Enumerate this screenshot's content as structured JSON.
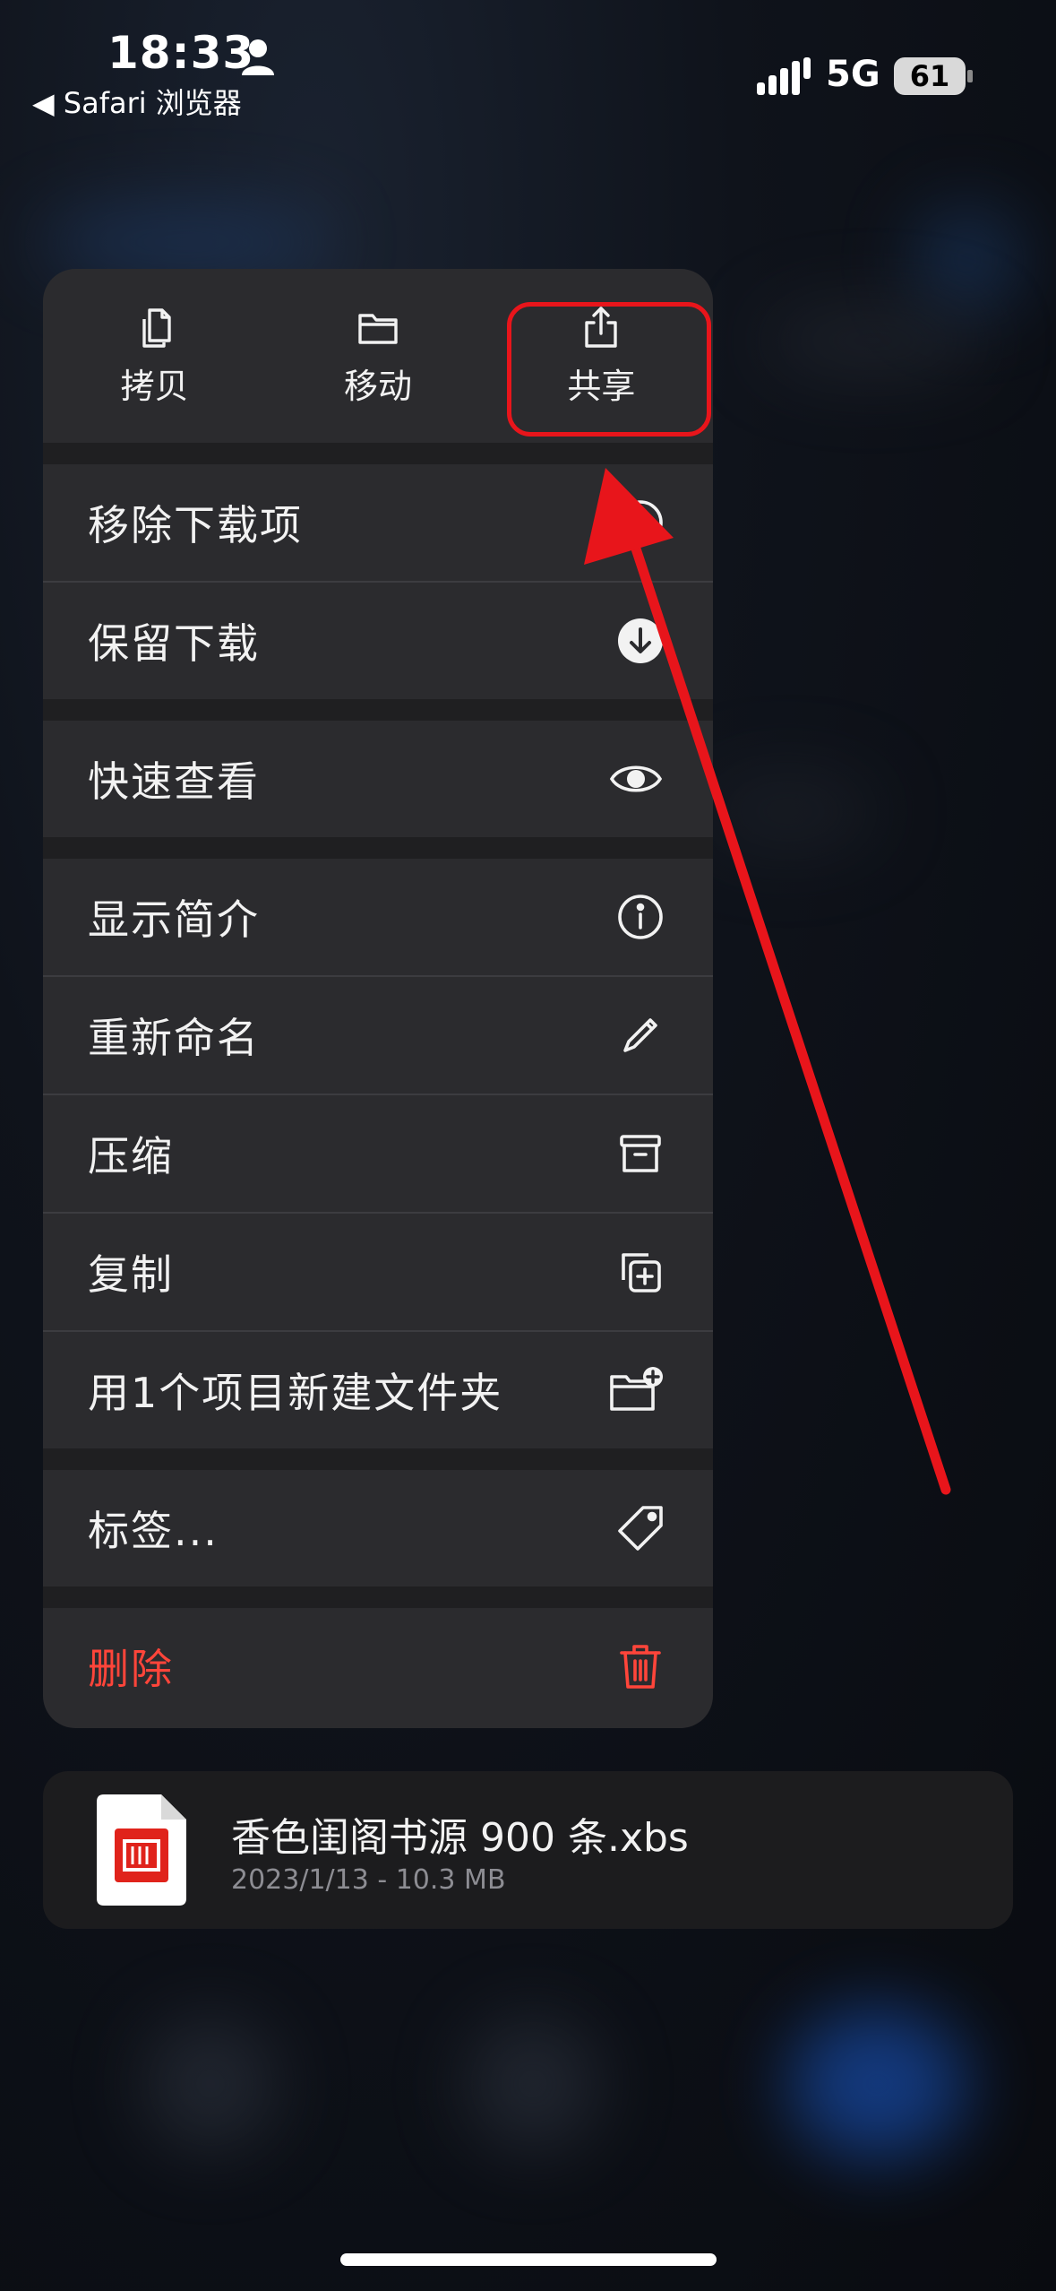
{
  "status_bar": {
    "time": "18:33",
    "back_app": "◀ Safari 浏览器",
    "network": "5G",
    "battery": "61"
  },
  "quick_actions": [
    {
      "label": "拷贝",
      "icon": "copy-icon"
    },
    {
      "label": "移动",
      "icon": "folder-icon"
    },
    {
      "label": "共享",
      "icon": "share-icon"
    }
  ],
  "menu": {
    "remove_download": "移除下载项",
    "keep_download": "保留下载",
    "quick_look": "快速查看",
    "get_info": "显示简介",
    "rename": "重新命名",
    "compress": "压缩",
    "duplicate": "复制",
    "new_folder": "用1个项目新建文件夹",
    "tags": "标签...",
    "delete": "删除"
  },
  "file": {
    "name": "香色闺阁书源 900 条.xbs",
    "meta": "2023/1/13 - 10.3 MB"
  },
  "colors": {
    "destructive": "#ff453a",
    "highlight": "#e8151b",
    "menu_bg": "#2b2b2e"
  }
}
